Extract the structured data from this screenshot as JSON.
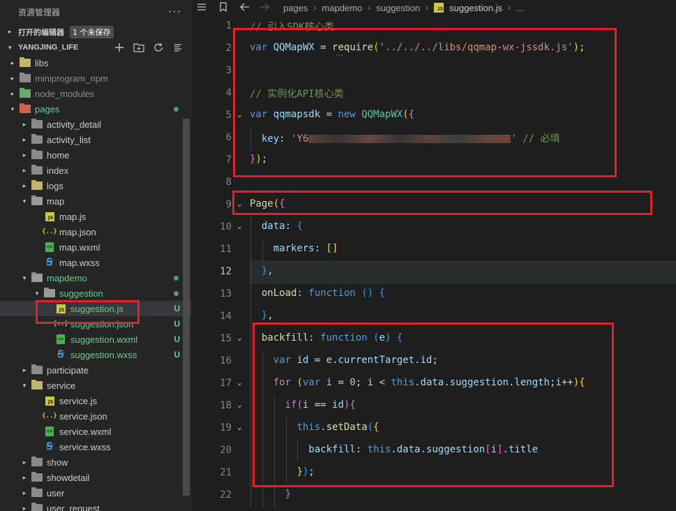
{
  "sidebar": {
    "title": "资源管理器",
    "more": "···",
    "open_editors": {
      "label": "打开的编辑器",
      "badge": "1 个未保存"
    },
    "project": {
      "name": "YANGJING_LIFE"
    },
    "tree": [
      {
        "label": "libs",
        "indent": 1,
        "arrow": "▸",
        "icon": "folder-yellow"
      },
      {
        "label": "miniprogram_npm",
        "indent": 1,
        "arrow": "▸",
        "icon": "folder",
        "dim": true
      },
      {
        "label": "node_modules",
        "indent": 1,
        "arrow": "▸",
        "icon": "folder-green",
        "dim": true
      },
      {
        "label": "pages",
        "indent": 1,
        "arrow": "▾",
        "icon": "folder-red",
        "green": true,
        "dot": true
      },
      {
        "label": "activity_detail",
        "indent": 2,
        "arrow": "▸",
        "icon": "folder"
      },
      {
        "label": "activity_list",
        "indent": 2,
        "arrow": "▸",
        "icon": "folder"
      },
      {
        "label": "home",
        "indent": 2,
        "arrow": "▸",
        "icon": "folder"
      },
      {
        "label": "index",
        "indent": 2,
        "arrow": "▸",
        "icon": "folder"
      },
      {
        "label": "logs",
        "indent": 2,
        "arrow": "▸",
        "icon": "folder-yellow"
      },
      {
        "label": "map",
        "indent": 2,
        "arrow": "▾",
        "icon": "folder-open"
      },
      {
        "label": "map.js",
        "indent": 3,
        "arrow": "",
        "icon": "js"
      },
      {
        "label": "map.json",
        "indent": 3,
        "arrow": "",
        "icon": "json"
      },
      {
        "label": "map.wxml",
        "indent": 3,
        "arrow": "",
        "icon": "wxml"
      },
      {
        "label": "map.wxss",
        "indent": 3,
        "arrow": "",
        "icon": "wxss"
      },
      {
        "label": "mapdemo",
        "indent": 2,
        "arrow": "▾",
        "icon": "folder-open",
        "green": true,
        "dot": true
      },
      {
        "label": "suggestion",
        "indent": 3,
        "arrow": "▾",
        "icon": "folder-open",
        "green": true,
        "dot": true
      },
      {
        "label": "suggestion.js",
        "indent": 4,
        "arrow": "",
        "icon": "js",
        "green": true,
        "status": "U",
        "selected": true
      },
      {
        "label": "suggestion.json",
        "indent": 4,
        "arrow": "",
        "icon": "json",
        "green": true,
        "status": "U"
      },
      {
        "label": "suggestion.wxml",
        "indent": 4,
        "arrow": "",
        "icon": "wxml",
        "green": true,
        "status": "U"
      },
      {
        "label": "suggestion.wxss",
        "indent": 4,
        "arrow": "",
        "icon": "wxss",
        "green": true,
        "status": "U"
      },
      {
        "label": "participate",
        "indent": 2,
        "arrow": "▸",
        "icon": "folder"
      },
      {
        "label": "service",
        "indent": 2,
        "arrow": "▾",
        "icon": "folder-open-yellow"
      },
      {
        "label": "service.js",
        "indent": 3,
        "arrow": "",
        "icon": "js"
      },
      {
        "label": "service.json",
        "indent": 3,
        "arrow": "",
        "icon": "json"
      },
      {
        "label": "service.wxml",
        "indent": 3,
        "arrow": "",
        "icon": "wxml"
      },
      {
        "label": "service.wxss",
        "indent": 3,
        "arrow": "",
        "icon": "wxss"
      },
      {
        "label": "show",
        "indent": 2,
        "arrow": "▸",
        "icon": "folder"
      },
      {
        "label": "showdetail",
        "indent": 2,
        "arrow": "▸",
        "icon": "folder"
      },
      {
        "label": "user",
        "indent": 2,
        "arrow": "▸",
        "icon": "folder"
      },
      {
        "label": "user_request",
        "indent": 2,
        "arrow": "▸",
        "icon": "folder"
      }
    ]
  },
  "breadcrumb": [
    "pages",
    "mapdemo",
    "suggestion",
    "suggestion.js",
    "..."
  ],
  "editor": {
    "active_line": 12,
    "lines": [
      {
        "n": 1,
        "fold": "",
        "indent": 0,
        "tokens": [
          [
            "cm",
            "// 引入SDK核心类"
          ]
        ]
      },
      {
        "n": 2,
        "fold": "",
        "indent": 0,
        "tokens": [
          [
            "kw",
            "var "
          ],
          [
            "var",
            "QQMapWX"
          ],
          [
            "pl",
            " = "
          ],
          [
            "fn",
            "require"
          ],
          [
            "b1",
            "("
          ],
          [
            "str",
            "'../../../libs/qqmap-wx-jssdk.js'"
          ],
          [
            "b1",
            ")"
          ],
          [
            "pl",
            ";"
          ]
        ]
      },
      {
        "n": 3,
        "fold": "",
        "indent": 0,
        "tokens": []
      },
      {
        "n": 4,
        "fold": "",
        "indent": 0,
        "tokens": [
          [
            "cm",
            "// 实例化API核心类"
          ]
        ]
      },
      {
        "n": 5,
        "fold": "⌄",
        "indent": 0,
        "tokens": [
          [
            "kw",
            "var "
          ],
          [
            "var",
            "qqmapsdk"
          ],
          [
            "pl",
            " = "
          ],
          [
            "kw",
            "new "
          ],
          [
            "cls",
            "QQMapWX"
          ],
          [
            "b1",
            "("
          ],
          [
            "b2",
            "{"
          ]
        ]
      },
      {
        "n": 6,
        "fold": "",
        "indent": 1,
        "tokens": [
          [
            "var",
            "key"
          ],
          [
            "pl",
            ": "
          ],
          [
            "str",
            "'Y6"
          ],
          [
            "blur",
            ""
          ],
          [
            "str",
            "'"
          ],
          [
            "pl",
            " "
          ],
          [
            "cm",
            "// 必填"
          ]
        ]
      },
      {
        "n": 7,
        "fold": "",
        "indent": 0,
        "tokens": [
          [
            "b2",
            "}"
          ],
          [
            "b1",
            ")"
          ],
          [
            "pl",
            ";"
          ]
        ]
      },
      {
        "n": 8,
        "fold": "",
        "indent": 0,
        "tokens": []
      },
      {
        "n": 9,
        "fold": "⌄",
        "indent": 0,
        "tokens": [
          [
            "fn",
            "Page"
          ],
          [
            "b1",
            "("
          ],
          [
            "b2",
            "{"
          ]
        ]
      },
      {
        "n": 10,
        "fold": "⌄",
        "indent": 1,
        "tokens": [
          [
            "var",
            "data"
          ],
          [
            "pl",
            ": "
          ],
          [
            "b3",
            "{"
          ]
        ]
      },
      {
        "n": 11,
        "fold": "",
        "indent": 2,
        "tokens": [
          [
            "var",
            "markers"
          ],
          [
            "pl",
            ": "
          ],
          [
            "b1",
            "[]"
          ]
        ]
      },
      {
        "n": 12,
        "fold": "",
        "indent": 1,
        "tokens": [
          [
            "b3",
            "}"
          ],
          [
            "pl",
            ","
          ]
        ]
      },
      {
        "n": 13,
        "fold": "",
        "indent": 1,
        "tokens": [
          [
            "fn",
            "onLoad"
          ],
          [
            "pl",
            ": "
          ],
          [
            "kw",
            "function "
          ],
          [
            "b3",
            "()"
          ],
          [
            "pl",
            " "
          ],
          [
            "b3",
            "{"
          ]
        ]
      },
      {
        "n": 14,
        "fold": "",
        "indent": 1,
        "tokens": [
          [
            "b3",
            "}"
          ],
          [
            "pl",
            ","
          ]
        ]
      },
      {
        "n": 15,
        "fold": "⌄",
        "indent": 1,
        "tokens": [
          [
            "fn",
            "backfill"
          ],
          [
            "pl",
            ": "
          ],
          [
            "kw",
            "function "
          ],
          [
            "b3",
            "("
          ],
          [
            "var",
            "e"
          ],
          [
            "b3",
            ")"
          ],
          [
            "pl",
            " "
          ],
          [
            "b3",
            "{"
          ]
        ]
      },
      {
        "n": 16,
        "fold": "",
        "indent": 2,
        "tokens": [
          [
            "kw",
            "var "
          ],
          [
            "var",
            "id"
          ],
          [
            "pl",
            " = "
          ],
          [
            "var",
            "e"
          ],
          [
            "pl",
            "."
          ],
          [
            "var",
            "currentTarget"
          ],
          [
            "pl",
            "."
          ],
          [
            "var",
            "id"
          ],
          [
            "pl",
            ";"
          ]
        ]
      },
      {
        "n": 17,
        "fold": "⌄",
        "indent": 2,
        "tokens": [
          [
            "ctl",
            "for "
          ],
          [
            "b1",
            "("
          ],
          [
            "kw",
            "var "
          ],
          [
            "var",
            "i"
          ],
          [
            "pl",
            " = "
          ],
          [
            "num",
            "0"
          ],
          [
            "pl",
            "; "
          ],
          [
            "var",
            "i"
          ],
          [
            "pl",
            " < "
          ],
          [
            "kw",
            "this"
          ],
          [
            "pl",
            "."
          ],
          [
            "var",
            "data"
          ],
          [
            "pl",
            "."
          ],
          [
            "var",
            "suggestion"
          ],
          [
            "pl",
            "."
          ],
          [
            "var",
            "length"
          ],
          [
            "pl",
            ";"
          ],
          [
            "var",
            "i"
          ],
          [
            "pl",
            "++"
          ],
          [
            "b1",
            ")"
          ],
          [
            "b1",
            "{"
          ]
        ]
      },
      {
        "n": 18,
        "fold": "⌄",
        "indent": 3,
        "tokens": [
          [
            "ctl",
            "if"
          ],
          [
            "b2",
            "("
          ],
          [
            "var",
            "i"
          ],
          [
            "pl",
            " == "
          ],
          [
            "var",
            "id"
          ],
          [
            "b2",
            ")"
          ],
          [
            "b2",
            "{"
          ]
        ]
      },
      {
        "n": 19,
        "fold": "⌄",
        "indent": 4,
        "tokens": [
          [
            "kw",
            "this"
          ],
          [
            "pl",
            "."
          ],
          [
            "fn",
            "setData"
          ],
          [
            "b3",
            "("
          ],
          [
            "b1",
            "{"
          ]
        ]
      },
      {
        "n": 20,
        "fold": "",
        "indent": 5,
        "tokens": [
          [
            "var",
            "backfill"
          ],
          [
            "pl",
            ": "
          ],
          [
            "kw",
            "this"
          ],
          [
            "pl",
            "."
          ],
          [
            "var",
            "data"
          ],
          [
            "pl",
            "."
          ],
          [
            "var",
            "suggestion"
          ],
          [
            "b2",
            "["
          ],
          [
            "var",
            "i"
          ],
          [
            "b2",
            "]"
          ],
          [
            "pl",
            "."
          ],
          [
            "var",
            "title"
          ]
        ]
      },
      {
        "n": 21,
        "fold": "",
        "indent": 4,
        "tokens": [
          [
            "b1",
            "}"
          ],
          [
            "b3",
            ")"
          ],
          [
            "pl",
            ";"
          ]
        ]
      },
      {
        "n": 22,
        "fold": "",
        "indent": 3,
        "tokens": [
          [
            "b2",
            "}"
          ]
        ]
      }
    ]
  }
}
